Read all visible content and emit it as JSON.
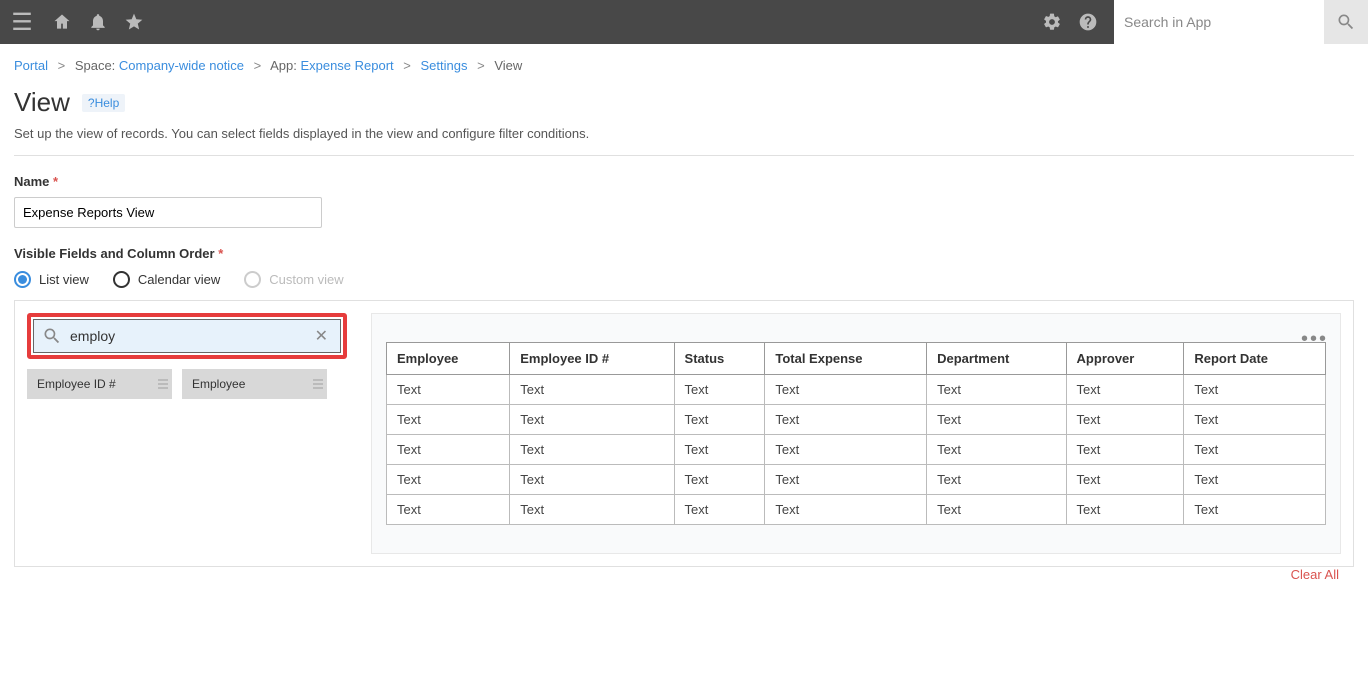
{
  "topbar": {
    "search_placeholder": "Search in App"
  },
  "breadcrumb": {
    "portal": "Portal",
    "space_label": "Space:",
    "space_name": "Company-wide notice",
    "app_label": "App:",
    "app_name": "Expense Report",
    "settings": "Settings",
    "view": "View"
  },
  "heading": {
    "title": "View",
    "help": "?Help",
    "description": "Set up the view of records. You can select fields displayed in the view and configure filter conditions."
  },
  "form": {
    "name_label": "Name",
    "name_value": "Expense Reports View",
    "visible_label": "Visible Fields and Column Order",
    "radios": {
      "list": "List view",
      "calendar": "Calendar view",
      "custom": "Custom view"
    },
    "field_search_value": "employ",
    "chips": [
      "Employee ID #",
      "Employee"
    ],
    "clear_all": "Clear All"
  },
  "table": {
    "headers": [
      "Employee",
      "Employee ID #",
      "Status",
      "Total Expense",
      "Department",
      "Approver",
      "Report Date"
    ],
    "rows": [
      [
        "Text",
        "Text",
        "Text",
        "Text",
        "Text",
        "Text",
        "Text"
      ],
      [
        "Text",
        "Text",
        "Text",
        "Text",
        "Text",
        "Text",
        "Text"
      ],
      [
        "Text",
        "Text",
        "Text",
        "Text",
        "Text",
        "Text",
        "Text"
      ],
      [
        "Text",
        "Text",
        "Text",
        "Text",
        "Text",
        "Text",
        "Text"
      ],
      [
        "Text",
        "Text",
        "Text",
        "Text",
        "Text",
        "Text",
        "Text"
      ]
    ]
  }
}
